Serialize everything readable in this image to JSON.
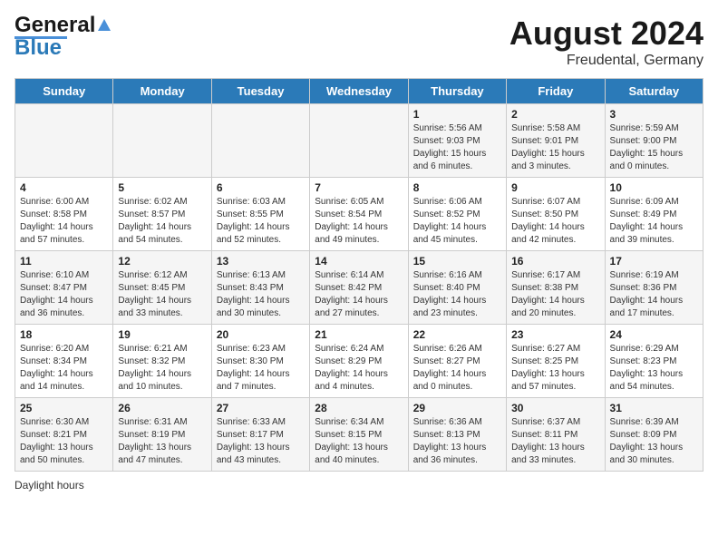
{
  "header": {
    "logo_general": "General",
    "logo_blue": "Blue",
    "title": "August 2024",
    "subtitle": "Freudental, Germany"
  },
  "days_of_week": [
    "Sunday",
    "Monday",
    "Tuesday",
    "Wednesday",
    "Thursday",
    "Friday",
    "Saturday"
  ],
  "weeks": [
    [
      {
        "day": "",
        "info": ""
      },
      {
        "day": "",
        "info": ""
      },
      {
        "day": "",
        "info": ""
      },
      {
        "day": "",
        "info": ""
      },
      {
        "day": "1",
        "info": "Sunrise: 5:56 AM\nSunset: 9:03 PM\nDaylight: 15 hours and 6 minutes."
      },
      {
        "day": "2",
        "info": "Sunrise: 5:58 AM\nSunset: 9:01 PM\nDaylight: 15 hours and 3 minutes."
      },
      {
        "day": "3",
        "info": "Sunrise: 5:59 AM\nSunset: 9:00 PM\nDaylight: 15 hours and 0 minutes."
      }
    ],
    [
      {
        "day": "4",
        "info": "Sunrise: 6:00 AM\nSunset: 8:58 PM\nDaylight: 14 hours and 57 minutes."
      },
      {
        "day": "5",
        "info": "Sunrise: 6:02 AM\nSunset: 8:57 PM\nDaylight: 14 hours and 54 minutes."
      },
      {
        "day": "6",
        "info": "Sunrise: 6:03 AM\nSunset: 8:55 PM\nDaylight: 14 hours and 52 minutes."
      },
      {
        "day": "7",
        "info": "Sunrise: 6:05 AM\nSunset: 8:54 PM\nDaylight: 14 hours and 49 minutes."
      },
      {
        "day": "8",
        "info": "Sunrise: 6:06 AM\nSunset: 8:52 PM\nDaylight: 14 hours and 45 minutes."
      },
      {
        "day": "9",
        "info": "Sunrise: 6:07 AM\nSunset: 8:50 PM\nDaylight: 14 hours and 42 minutes."
      },
      {
        "day": "10",
        "info": "Sunrise: 6:09 AM\nSunset: 8:49 PM\nDaylight: 14 hours and 39 minutes."
      }
    ],
    [
      {
        "day": "11",
        "info": "Sunrise: 6:10 AM\nSunset: 8:47 PM\nDaylight: 14 hours and 36 minutes."
      },
      {
        "day": "12",
        "info": "Sunrise: 6:12 AM\nSunset: 8:45 PM\nDaylight: 14 hours and 33 minutes."
      },
      {
        "day": "13",
        "info": "Sunrise: 6:13 AM\nSunset: 8:43 PM\nDaylight: 14 hours and 30 minutes."
      },
      {
        "day": "14",
        "info": "Sunrise: 6:14 AM\nSunset: 8:42 PM\nDaylight: 14 hours and 27 minutes."
      },
      {
        "day": "15",
        "info": "Sunrise: 6:16 AM\nSunset: 8:40 PM\nDaylight: 14 hours and 23 minutes."
      },
      {
        "day": "16",
        "info": "Sunrise: 6:17 AM\nSunset: 8:38 PM\nDaylight: 14 hours and 20 minutes."
      },
      {
        "day": "17",
        "info": "Sunrise: 6:19 AM\nSunset: 8:36 PM\nDaylight: 14 hours and 17 minutes."
      }
    ],
    [
      {
        "day": "18",
        "info": "Sunrise: 6:20 AM\nSunset: 8:34 PM\nDaylight: 14 hours and 14 minutes."
      },
      {
        "day": "19",
        "info": "Sunrise: 6:21 AM\nSunset: 8:32 PM\nDaylight: 14 hours and 10 minutes."
      },
      {
        "day": "20",
        "info": "Sunrise: 6:23 AM\nSunset: 8:30 PM\nDaylight: 14 hours and 7 minutes."
      },
      {
        "day": "21",
        "info": "Sunrise: 6:24 AM\nSunset: 8:29 PM\nDaylight: 14 hours and 4 minutes."
      },
      {
        "day": "22",
        "info": "Sunrise: 6:26 AM\nSunset: 8:27 PM\nDaylight: 14 hours and 0 minutes."
      },
      {
        "day": "23",
        "info": "Sunrise: 6:27 AM\nSunset: 8:25 PM\nDaylight: 13 hours and 57 minutes."
      },
      {
        "day": "24",
        "info": "Sunrise: 6:29 AM\nSunset: 8:23 PM\nDaylight: 13 hours and 54 minutes."
      }
    ],
    [
      {
        "day": "25",
        "info": "Sunrise: 6:30 AM\nSunset: 8:21 PM\nDaylight: 13 hours and 50 minutes."
      },
      {
        "day": "26",
        "info": "Sunrise: 6:31 AM\nSunset: 8:19 PM\nDaylight: 13 hours and 47 minutes."
      },
      {
        "day": "27",
        "info": "Sunrise: 6:33 AM\nSunset: 8:17 PM\nDaylight: 13 hours and 43 minutes."
      },
      {
        "day": "28",
        "info": "Sunrise: 6:34 AM\nSunset: 8:15 PM\nDaylight: 13 hours and 40 minutes."
      },
      {
        "day": "29",
        "info": "Sunrise: 6:36 AM\nSunset: 8:13 PM\nDaylight: 13 hours and 36 minutes."
      },
      {
        "day": "30",
        "info": "Sunrise: 6:37 AM\nSunset: 8:11 PM\nDaylight: 13 hours and 33 minutes."
      },
      {
        "day": "31",
        "info": "Sunrise: 6:39 AM\nSunset: 8:09 PM\nDaylight: 13 hours and 30 minutes."
      }
    ]
  ],
  "footer": {
    "text": "Daylight hours"
  }
}
